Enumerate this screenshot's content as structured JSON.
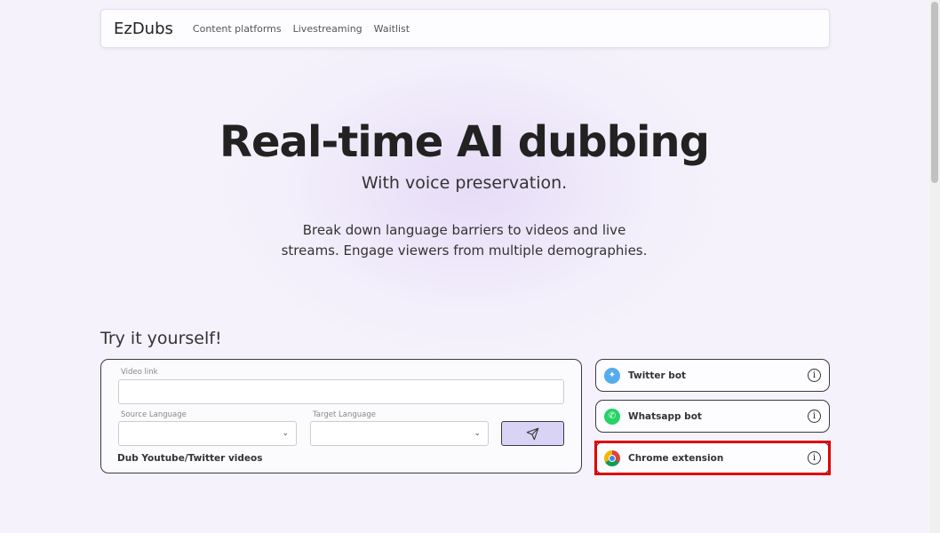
{
  "nav": {
    "logo": "EzDubs",
    "links": [
      "Content platforms",
      "Livestreaming",
      "Waitlist"
    ]
  },
  "hero": {
    "title": "Real-time AI dubbing",
    "subtitle": "With voice preservation.",
    "desc1": "Break down language barriers to videos and live",
    "desc2": "streams. Engage viewers from multiple demographies."
  },
  "try": {
    "heading": "Try it yourself!",
    "video_label": "Video link",
    "video_value": "",
    "source_label": "Source Language",
    "source_value": "",
    "target_label": "Target Language",
    "target_value": "",
    "caption": "Dub Youtube/Twitter videos"
  },
  "options": [
    {
      "label": "Twitter bot",
      "icon": "twitter-icon",
      "color": "#55acee"
    },
    {
      "label": "Whatsapp bot",
      "icon": "whatsapp-icon",
      "color": "#25d366"
    },
    {
      "label": "Chrome extension",
      "icon": "chrome-icon"
    }
  ],
  "highlight_color": "#e00000"
}
